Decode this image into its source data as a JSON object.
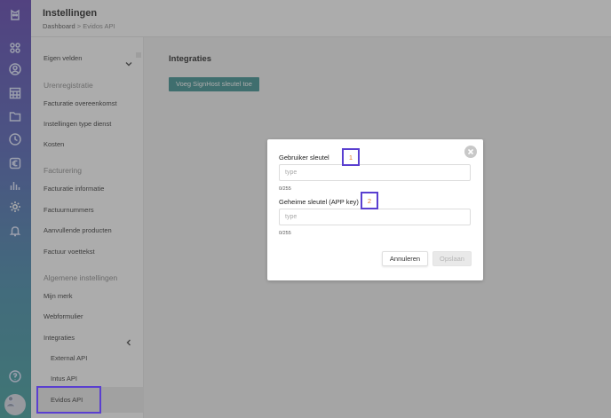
{
  "header": {
    "title": "Instellingen",
    "breadcrumb_root": "Dashboard",
    "breadcrumb_sep": " > ",
    "breadcrumb_current": "Evidos API"
  },
  "rail": {
    "icons": [
      "logo-icon",
      "apps-icon",
      "user-circle-icon",
      "calendar-icon",
      "folder-icon",
      "clock-icon",
      "euro-icon",
      "bar-chart-icon",
      "gear-icon",
      "bell-icon",
      "help-icon",
      "avatar"
    ]
  },
  "sidebar": {
    "custom_fields": "Eigen velden",
    "sections": {
      "hours": "Urenregistratie",
      "billing": "Facturering",
      "general": "Algemene instellingen"
    },
    "hours_items": [
      "Facturatie overeenkomst",
      "Instellingen type dienst",
      "Kosten"
    ],
    "billing_items": [
      "Facturatie informatie",
      "Factuurnummers",
      "Aanvullende producten",
      "Factuur voettekst"
    ],
    "general_items": [
      "Mijn merk",
      "Webformulier",
      "Integraties"
    ],
    "integration_items": [
      "External API",
      "Intus API",
      "Evidos API"
    ]
  },
  "main": {
    "heading": "Integraties",
    "add_button": "Voeg SignHost sleutel toe"
  },
  "modal": {
    "user_key_label": "Gebruiker sleutel",
    "user_key_placeholder": "type",
    "user_key_value": "",
    "user_key_count": "0/255",
    "secret_key_label": "Geheime sleutel (APP key)",
    "secret_key_placeholder": "type",
    "secret_key_value": "",
    "secret_key_count": "0/255",
    "cancel_label": "Annuleren",
    "save_label": "Opslaan"
  },
  "annotations": {
    "one": "1",
    "two": "2"
  },
  "colors": {
    "accent": "#3a8f8f",
    "annotation_border": "#5a3fd0",
    "annotation_text": "#e07a2e",
    "rail_top": "#5b3fb0",
    "rail_bottom": "#3a9d9a"
  }
}
